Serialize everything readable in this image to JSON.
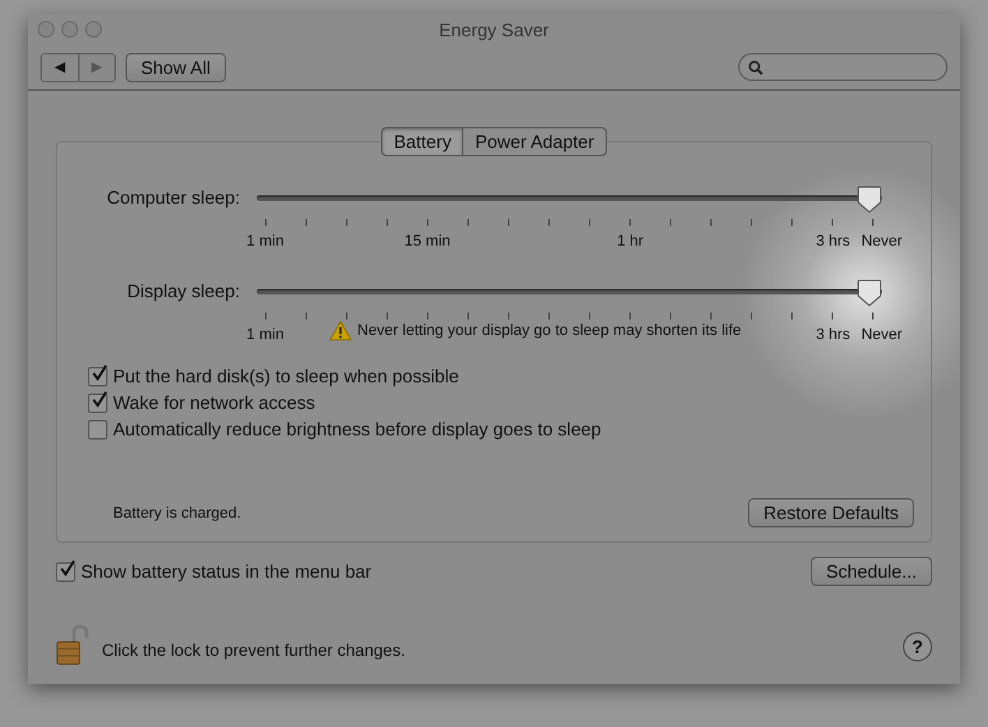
{
  "window": {
    "title": "Energy Saver"
  },
  "toolbar": {
    "back": "◀",
    "forward": "▶",
    "show_all": "Show All"
  },
  "tabs": [
    {
      "label": "Battery",
      "selected": true
    },
    {
      "label": "Power Adapter",
      "selected": false
    }
  ],
  "sliders": [
    {
      "label": "Computer sleep:",
      "level": 1,
      "tick_labels": [
        "1 min",
        "15 min",
        "1 hr",
        "3 hrs",
        "Never"
      ]
    },
    {
      "label": "Display sleep:",
      "level": 1,
      "tick_labels": [
        "1 min",
        "3 hrs",
        "Never"
      ],
      "warning": "Never letting your display go to sleep may shorten its life"
    }
  ],
  "options": [
    {
      "label": "Put the hard disk(s) to sleep when possible",
      "checked": true
    },
    {
      "label": "Wake for network access",
      "checked": true
    },
    {
      "label": "Automatically reduce brightness before display goes to sleep",
      "checked": false
    }
  ],
  "status": "Battery is charged.",
  "restore_button": "Restore Defaults",
  "menu_bar_option": {
    "label": "Show battery status in the menu bar",
    "checked": true
  },
  "schedule_button": "Schedule...",
  "lock_text": "Click the lock to prevent further changes.",
  "help": "?"
}
